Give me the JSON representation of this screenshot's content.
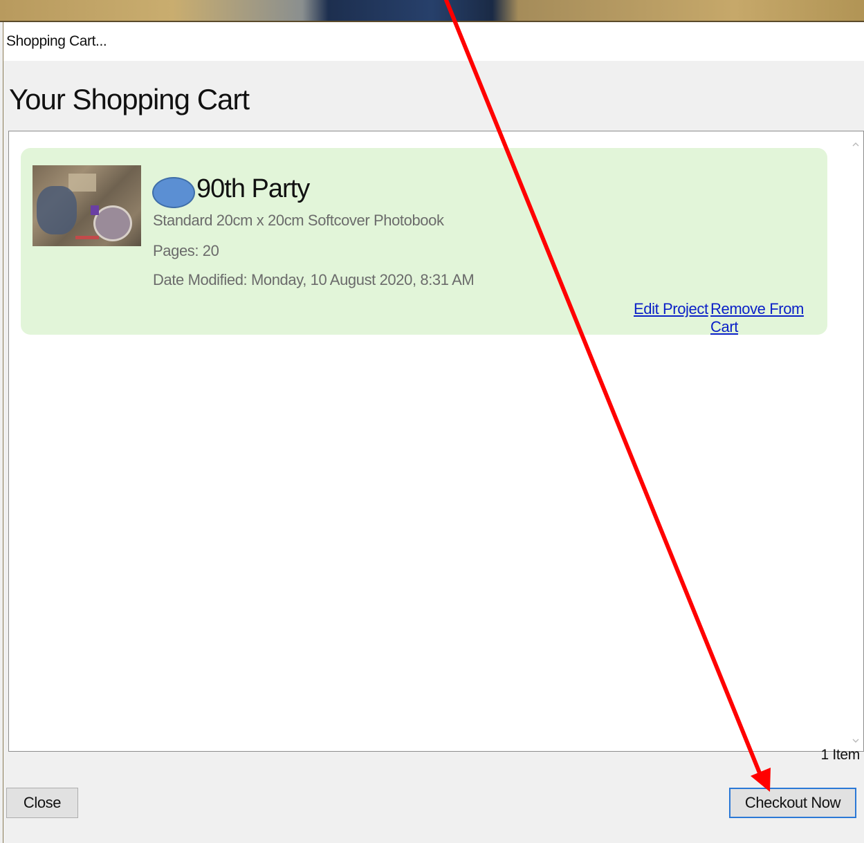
{
  "window": {
    "title": "Shopping Cart..."
  },
  "heading": "Your Shopping Cart",
  "cart": {
    "items": [
      {
        "title": "90th Party",
        "description": "Standard 20cm x 20cm Softcover Photobook",
        "pages": "Pages: 20",
        "date_modified": "Date Modified: Monday, 10 August 2020, 8:31 AM",
        "edit_label": "Edit Project",
        "remove_label": "Remove From Cart"
      }
    ],
    "item_count": "1 Item"
  },
  "buttons": {
    "close_label": "Close",
    "checkout_label": "Checkout Now"
  },
  "colors": {
    "card_background": "#e2f5d9",
    "link": "#0a1fc7",
    "annotation_arrow": "#ff0000",
    "redaction": "#5b8fd3"
  },
  "icons": {
    "scroll_up": "chevron-up-icon",
    "scroll_down": "chevron-down-icon"
  }
}
